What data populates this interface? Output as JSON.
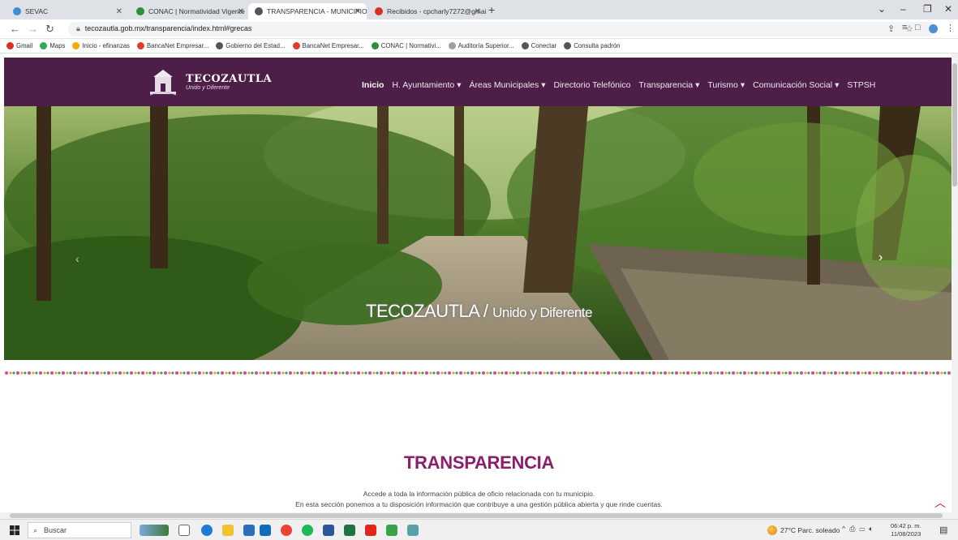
{
  "browser": {
    "tabs": [
      {
        "title": "SEVAC",
        "active": false,
        "icon": "sevac-icon",
        "color": "#3d8fd1"
      },
      {
        "title": "CONAC | Normatividad Vigente",
        "active": false,
        "icon": "conac-icon",
        "color": "#2c8f3a"
      },
      {
        "title": "TRANSPARENCIA - MUNICIPIO D",
        "active": true,
        "icon": "globe-icon",
        "color": "#555555"
      },
      {
        "title": "Recibidos - cpcharly7272@gmai",
        "active": false,
        "icon": "gmail-icon",
        "color": "#d93025"
      }
    ],
    "new_tab_label": "+",
    "url": "tecozautla.gob.mx/transparencia/index.html#grecas",
    "bookmarks": [
      {
        "label": "Gmail",
        "icon": "gmail-icon",
        "color": "#d93025"
      },
      {
        "label": "Maps",
        "icon": "maps-icon",
        "color": "#34a853"
      },
      {
        "label": "Inicio - efinanzas",
        "icon": "efinanzas-icon",
        "color": "#f2a900"
      },
      {
        "label": "BancaNet Empresar...",
        "icon": "bancanet-icon",
        "color": "#e03c31"
      },
      {
        "label": "Gobierno del Estad...",
        "icon": "globe-icon",
        "color": "#555555"
      },
      {
        "label": "BancaNet Empresar...",
        "icon": "bancanet-icon",
        "color": "#e03c31"
      },
      {
        "label": "CONAC | Normativi...",
        "icon": "conac-icon",
        "color": "#2c8f3a"
      },
      {
        "label": "Auditoría Superior...",
        "icon": "auditoria-icon",
        "color": "#9e9e9e"
      },
      {
        "label": "Conectar",
        "icon": "globe-icon",
        "color": "#555555"
      },
      {
        "label": "Consulta padrón",
        "icon": "globe-icon",
        "color": "#555555"
      }
    ]
  },
  "site": {
    "logo_name": "TECOZAUTLA",
    "logo_tagline": "Unido y Diferente",
    "menu": [
      {
        "label": "Inicio",
        "active": true,
        "dropdown": false
      },
      {
        "label": "H. Ayuntamiento",
        "active": false,
        "dropdown": true
      },
      {
        "label": "Áreas Municipales",
        "active": false,
        "dropdown": true
      },
      {
        "label": "Directorio Telefónico",
        "active": false,
        "dropdown": false
      },
      {
        "label": "Transparencia",
        "active": false,
        "dropdown": true
      },
      {
        "label": "Turismo",
        "active": false,
        "dropdown": true
      },
      {
        "label": "Comunicación Social",
        "active": false,
        "dropdown": true
      },
      {
        "label": "STPSH",
        "active": false,
        "dropdown": false
      }
    ],
    "hero_caption_main": "TECOZAUTLA /",
    "hero_caption_sub": "Unido y Diferente",
    "section_title": "TRANSPARENCIA",
    "intro_line1": "Accede a toda la información pública de oficio relacionada con tu municipio.",
    "intro_line2": "En esta sección ponemos a tu disposición información que contribuye a una gestión pública abierta y que rinde cuentas.",
    "accent_color": "#8a1f6c",
    "nav_bg": "#4d1f48"
  },
  "taskbar": {
    "search_placeholder": "Buscar",
    "weather": "27°C  Parc. soleado",
    "time": "06:42 p. m.",
    "date": "11/08/2023"
  }
}
